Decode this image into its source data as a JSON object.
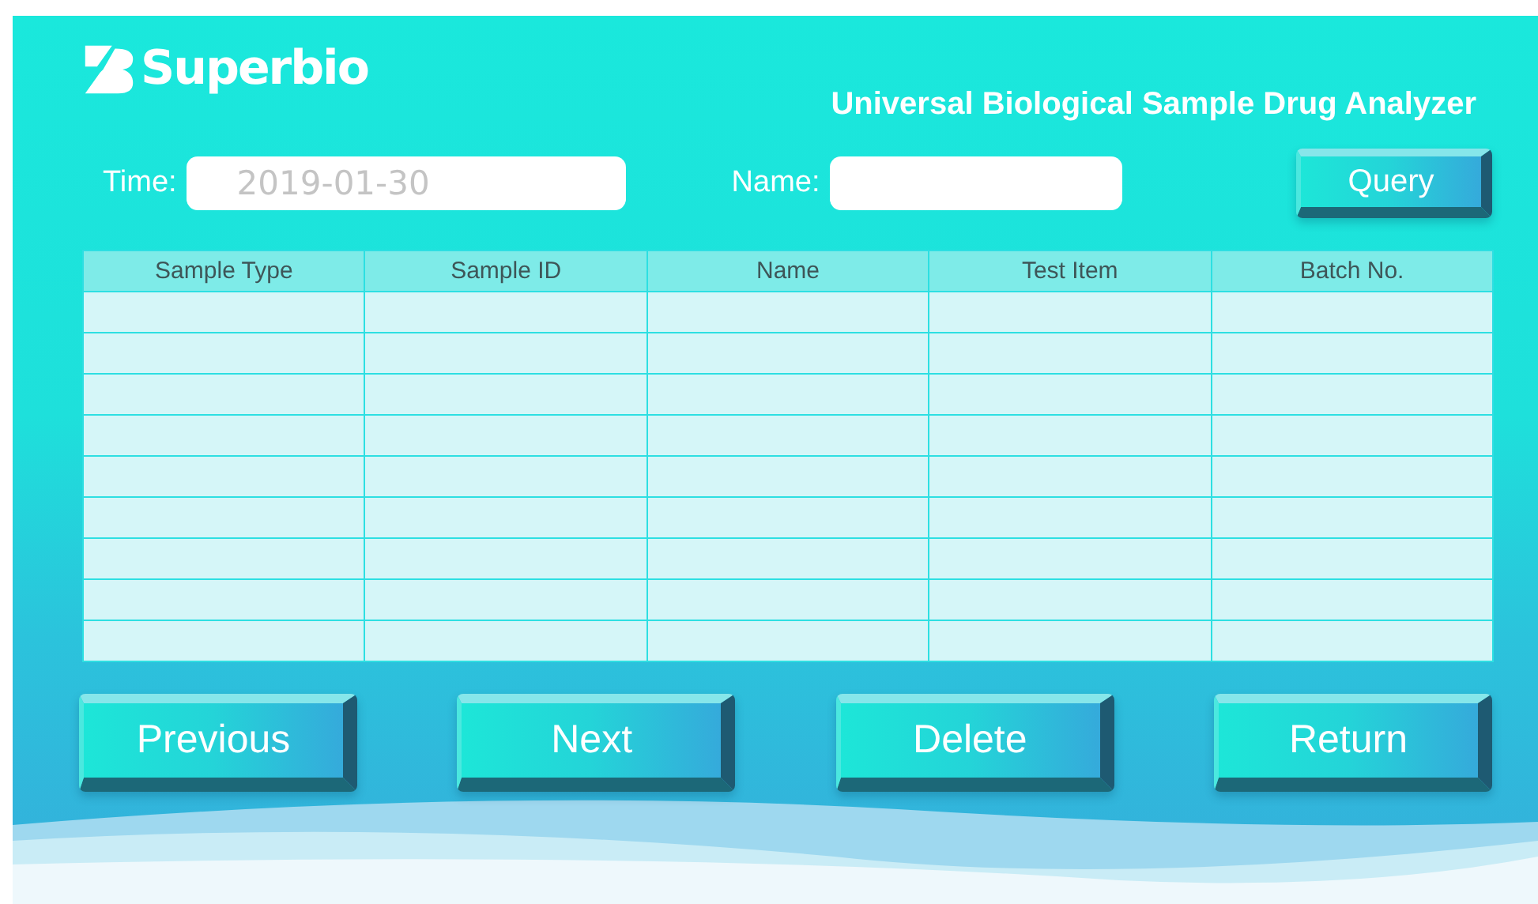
{
  "header": {
    "logo_text": "Superbio",
    "title": "Universal Biological Sample Drug Analyzer"
  },
  "filters": [
    {
      "label": "Time:",
      "placeholder": "2019-01-30"
    },
    {
      "label": "Name:"
    }
  ],
  "query_button": "Query",
  "table": {
    "columns": [
      "Sample Type",
      "Sample ID",
      "Name",
      "Test Item",
      "Batch No."
    ]
  },
  "buttons": [
    "Previous",
    "Next",
    "Delete",
    "Return"
  ]
}
